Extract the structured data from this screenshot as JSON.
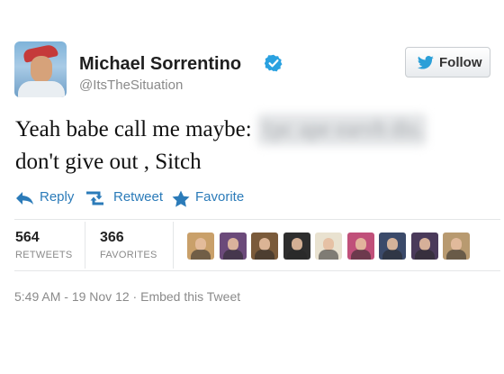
{
  "user": {
    "name": "Michael Sorrentino",
    "handle": "@ItsTheSituation",
    "verified": true
  },
  "follow_button": {
    "label": "Follow"
  },
  "tweet": {
    "line1": "Yeah babe call me maybe:",
    "redacted": "1pc ape earvh dis.",
    "line2": "don't give out , Sitch"
  },
  "actions": {
    "reply": "Reply",
    "retweet": "Retweet",
    "favorite": "Favorite"
  },
  "stats": {
    "retweets": {
      "count": "564",
      "label": "RETWEETS"
    },
    "favorites": {
      "count": "366",
      "label": "FAVORITES"
    }
  },
  "favoriter_avatars": [
    {
      "bg": "#c9a06a"
    },
    {
      "bg": "#6b4a7a"
    },
    {
      "bg": "#7a5a3a"
    },
    {
      "bg": "#2e2e2e"
    },
    {
      "bg": "#e9e2d0"
    },
    {
      "bg": "#c0507a"
    },
    {
      "bg": "#3b4a6a"
    },
    {
      "bg": "#4a3a5a"
    },
    {
      "bg": "#b89a70"
    }
  ],
  "meta": {
    "time": "5:49 AM",
    "date": "19 Nov 12",
    "separator_dash": "-",
    "separator_dot": "·",
    "embed": "Embed this Tweet"
  },
  "colors": {
    "link": "#2b7bb9",
    "verified": "#2aa1e0",
    "twitter_bird": "#2a9fd8"
  }
}
